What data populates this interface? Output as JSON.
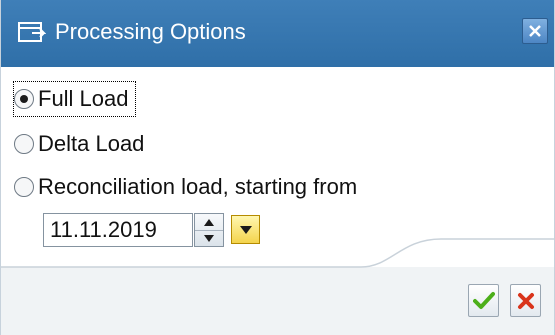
{
  "dialog": {
    "title": "Processing Options",
    "title_icon": "dialog-icon",
    "close_icon": "close-icon"
  },
  "options": [
    {
      "label": "Full Load",
      "selected": true
    },
    {
      "label": "Delta Load",
      "selected": false
    },
    {
      "label": "Reconciliation load, starting from",
      "selected": false
    }
  ],
  "date_field": {
    "value": "11.11.2019",
    "spinner_icon": "spinner-icon",
    "value_help_icon": "dropdown-arrow-icon"
  },
  "actions": {
    "ok_icon": "checkmark-icon",
    "cancel_icon": "cancel-icon",
    "ok_color": "#4caf1a",
    "cancel_color": "#d9341b"
  },
  "colors": {
    "titlebar": "#3476b0",
    "value_help": "#f4d44d"
  }
}
